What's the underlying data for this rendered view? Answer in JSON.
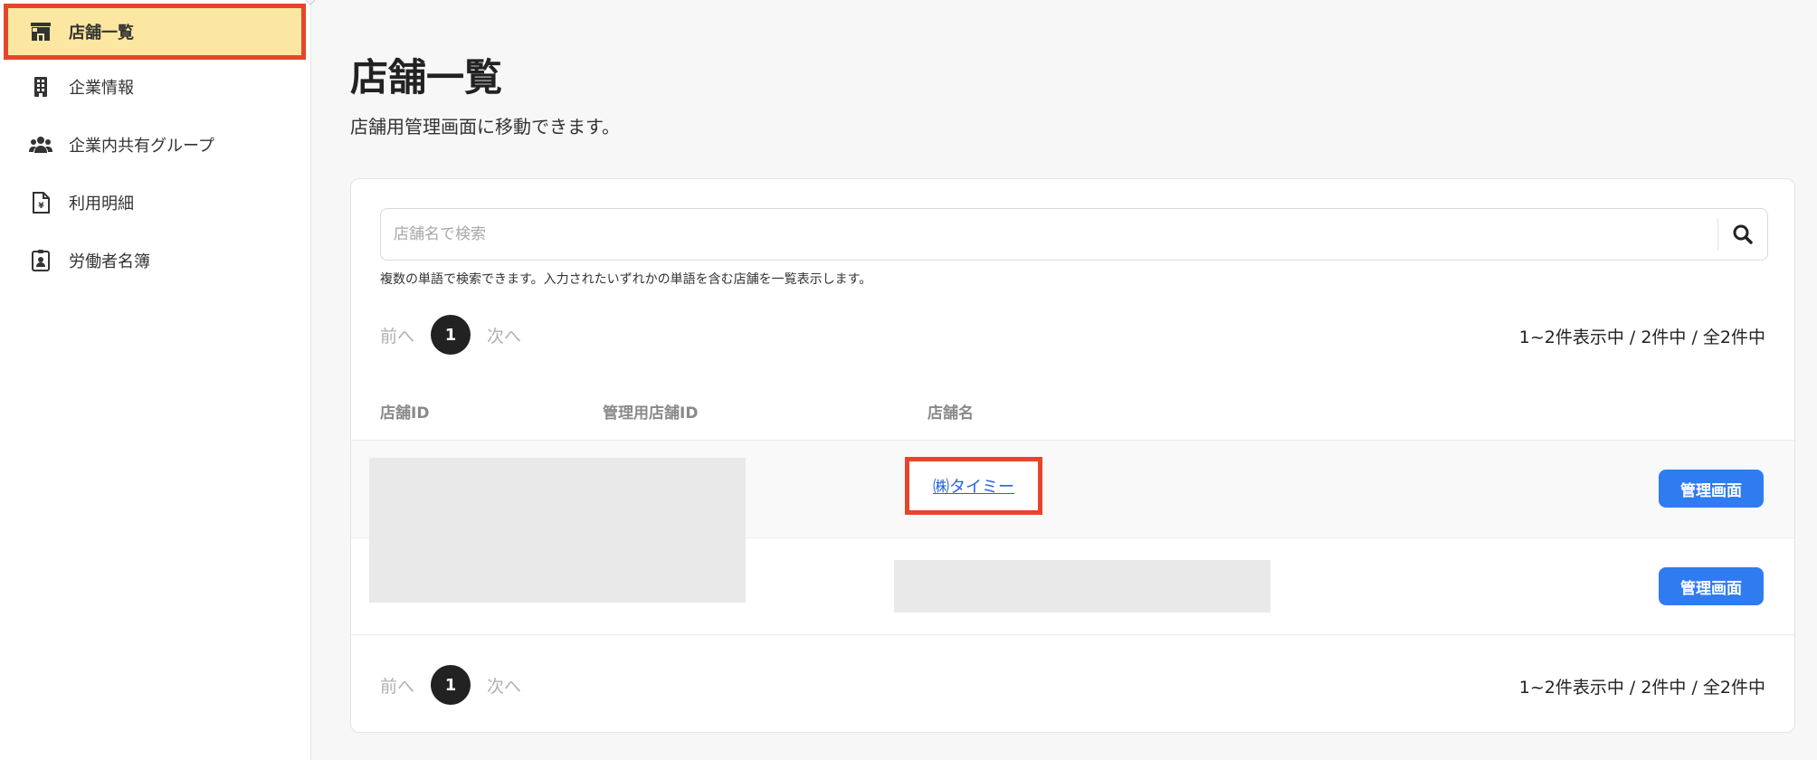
{
  "sidebar": {
    "items": [
      {
        "label": "店舗一覧",
        "icon": "store-icon",
        "active": true
      },
      {
        "label": "企業情報",
        "icon": "building-icon",
        "active": false
      },
      {
        "label": "企業内共有グループ",
        "icon": "users-icon",
        "active": false
      },
      {
        "label": "利用明細",
        "icon": "yen-document-icon",
        "active": false
      },
      {
        "label": "労働者名簿",
        "icon": "id-badge-icon",
        "active": false
      }
    ]
  },
  "main": {
    "title": "店舗一覧",
    "subtitle": "店舗用管理画面に移動できます。",
    "search": {
      "placeholder": "店舗名で検索",
      "value": "",
      "hint": "複数の単語で検索できます。入力されたいずれかの単語を含む店舗を一覧表示します。"
    },
    "pagination": {
      "prev_label": "前へ",
      "next_label": "次へ",
      "current_page": "1",
      "count_text": "1~2件表示中 / 2件中 / 全2件中"
    },
    "table": {
      "columns": [
        "店舗ID",
        "管理用店舗ID",
        "店舗名"
      ],
      "rows": [
        {
          "store_id": "",
          "admin_store_id": "",
          "store_name": "㈱タイミー",
          "action_label": "管理画面"
        },
        {
          "store_id": "",
          "admin_store_id": "",
          "store_name": "",
          "action_label": "管理画面"
        }
      ]
    }
  },
  "colors": {
    "active_bg": "#fbe7a1",
    "highlight_border": "#e8442a",
    "button_blue": "#2f7cf0",
    "link_blue": "#2a62d8"
  }
}
